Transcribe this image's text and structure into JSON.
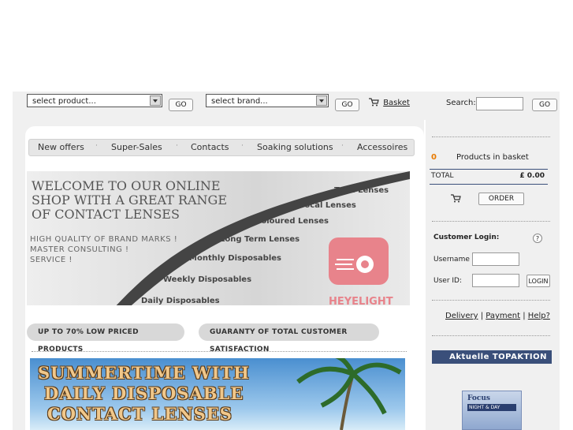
{
  "top_bar": {
    "product_select": "select product...",
    "product_go": "GO",
    "brand_select": "select brand...",
    "brand_go": "GO",
    "basket_label": "Basket",
    "search_label": "Search:",
    "search_value": "",
    "search_go": "GO"
  },
  "nav": {
    "items": [
      "New offers",
      "Super-Sales",
      "Contacts",
      "Soaking solutions",
      "Accessoires"
    ]
  },
  "banner": {
    "headline": [
      "WELCOME TO OUR ONLINE",
      "SHOP WITH A GREAT RANGE",
      "OF CONTACT LENSES"
    ],
    "subline": [
      "HIGH QUALITY OF BRAND MARKS !",
      "MASTER CONSULTING !",
      "SERVICE !"
    ],
    "steps": [
      "Toric Lenses",
      "Bifocal Lenses",
      "Coloured  Lenses",
      "Long Term Lenses",
      "Monthly Disposables",
      "Weekly Disposables",
      "Daily Disposables"
    ],
    "logo_text": "HEYELIGHT"
  },
  "promos": {
    "left": "UP TO 70% LOW PRICED PRODUCTS",
    "right": "GUARANTY OF TOTAL CUSTOMER SATISFACTION"
  },
  "summer": {
    "lines": [
      "SUMMERTIME WITH",
      "DAILY DISPOSABLE",
      "CONTACT LENSES"
    ]
  },
  "basket": {
    "count": "0",
    "count_label": "Products in basket",
    "total_label": "TOTAL",
    "total_value": "£ 0.00",
    "order_button": "ORDER"
  },
  "login": {
    "title": "Customer Login:",
    "help": "?",
    "username_label": "Username",
    "username_value": "",
    "userid_label": "User ID:",
    "userid_value": "",
    "login_button": "LOGIN"
  },
  "links": {
    "delivery": "Delivery",
    "payment": "Payment",
    "help": "Help?",
    "sep": "|"
  },
  "topaction": {
    "title": "Aktuelle TOPAKTION",
    "product_lines": [
      "Focus",
      "NIGHT & DAY"
    ]
  },
  "colors": {
    "accent_orange": "#e87a00",
    "topaction_bg": "#3a4f7a",
    "logo_red": "#e8838b"
  }
}
